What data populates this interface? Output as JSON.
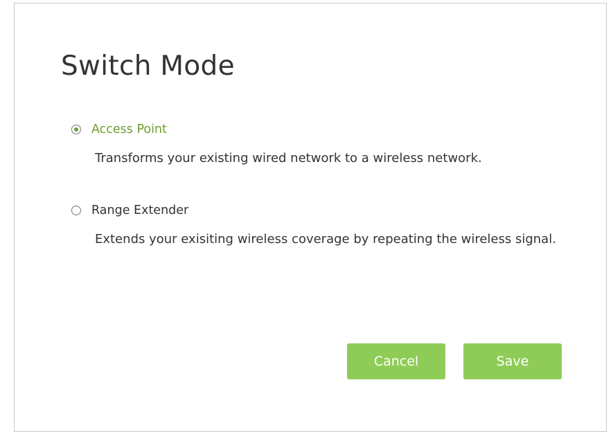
{
  "dialog": {
    "title": "Switch Mode"
  },
  "options": [
    {
      "label": "Access Point",
      "description": "Transforms your existing wired network to a wireless network.",
      "selected": true
    },
    {
      "label": "Range Extender",
      "description": "Extends your exisiting wireless coverage by repeating the wireless signal.",
      "selected": false
    }
  ],
  "buttons": {
    "cancel_label": "Cancel",
    "save_label": "Save"
  },
  "colors": {
    "accent": "#8fcc57",
    "selected_text": "#6f9f2f",
    "text": "#333333"
  }
}
